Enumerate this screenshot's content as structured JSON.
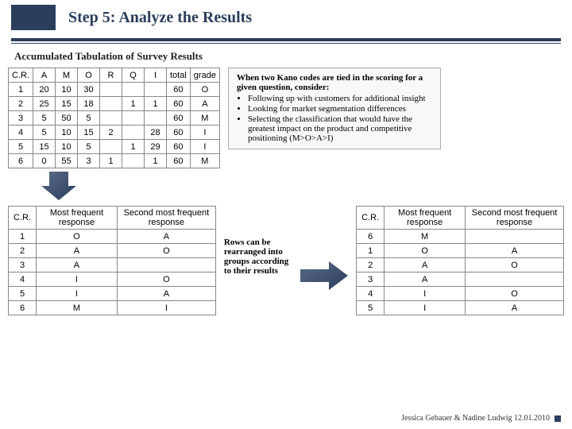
{
  "header": {
    "title": "Step 5: Analyze the Results"
  },
  "subtitle": "Accumulated Tabulation of Survey Results",
  "main_table": {
    "headers": [
      "C.R.",
      "A",
      "M",
      "O",
      "R",
      "Q",
      "I",
      "total",
      "grade"
    ],
    "rows": [
      [
        "1",
        "20",
        "10",
        "30",
        "",
        "",
        "",
        "60",
        "O"
      ],
      [
        "2",
        "25",
        "15",
        "18",
        "",
        "1",
        "1",
        "60",
        "A"
      ],
      [
        "3",
        "5",
        "50",
        "5",
        "",
        "",
        "",
        "60",
        "M"
      ],
      [
        "4",
        "5",
        "10",
        "15",
        "2",
        "",
        "28",
        "60",
        "I"
      ],
      [
        "5",
        "15",
        "10",
        "5",
        "",
        "1",
        "29",
        "60",
        "I"
      ],
      [
        "6",
        "0",
        "55",
        "3",
        "1",
        "",
        "1",
        "60",
        "M"
      ]
    ]
  },
  "info_box": {
    "lead": "When two Kano codes are tied in the scoring for a given question, consider:",
    "bullets": [
      "Following up with customers for additional insight",
      "Looking for market segmentation differences",
      "Selecting the classification that would have the greatest impact on the product and competitive positioning (M>O>A>I)"
    ]
  },
  "mid_text": "Rows can be rearranged into groups according to their results",
  "small_table_headers": [
    "C.R.",
    "Most frequent response",
    "Second most frequent response"
  ],
  "left_small_table": [
    [
      "1",
      "O",
      "A"
    ],
    [
      "2",
      "A",
      "O"
    ],
    [
      "3",
      "A",
      ""
    ],
    [
      "4",
      "I",
      "O"
    ],
    [
      "5",
      "I",
      "A"
    ],
    [
      "6",
      "M",
      "I"
    ]
  ],
  "right_small_table": [
    [
      "6",
      "M",
      ""
    ],
    [
      "1",
      "O",
      "A"
    ],
    [
      "2",
      "A",
      "O"
    ],
    [
      "3",
      "A",
      ""
    ],
    [
      "4",
      "I",
      "O"
    ],
    [
      "5",
      "I",
      "A"
    ]
  ],
  "footer": "Jessica Gebauer & Nadine Ludwig 12.01.2010"
}
